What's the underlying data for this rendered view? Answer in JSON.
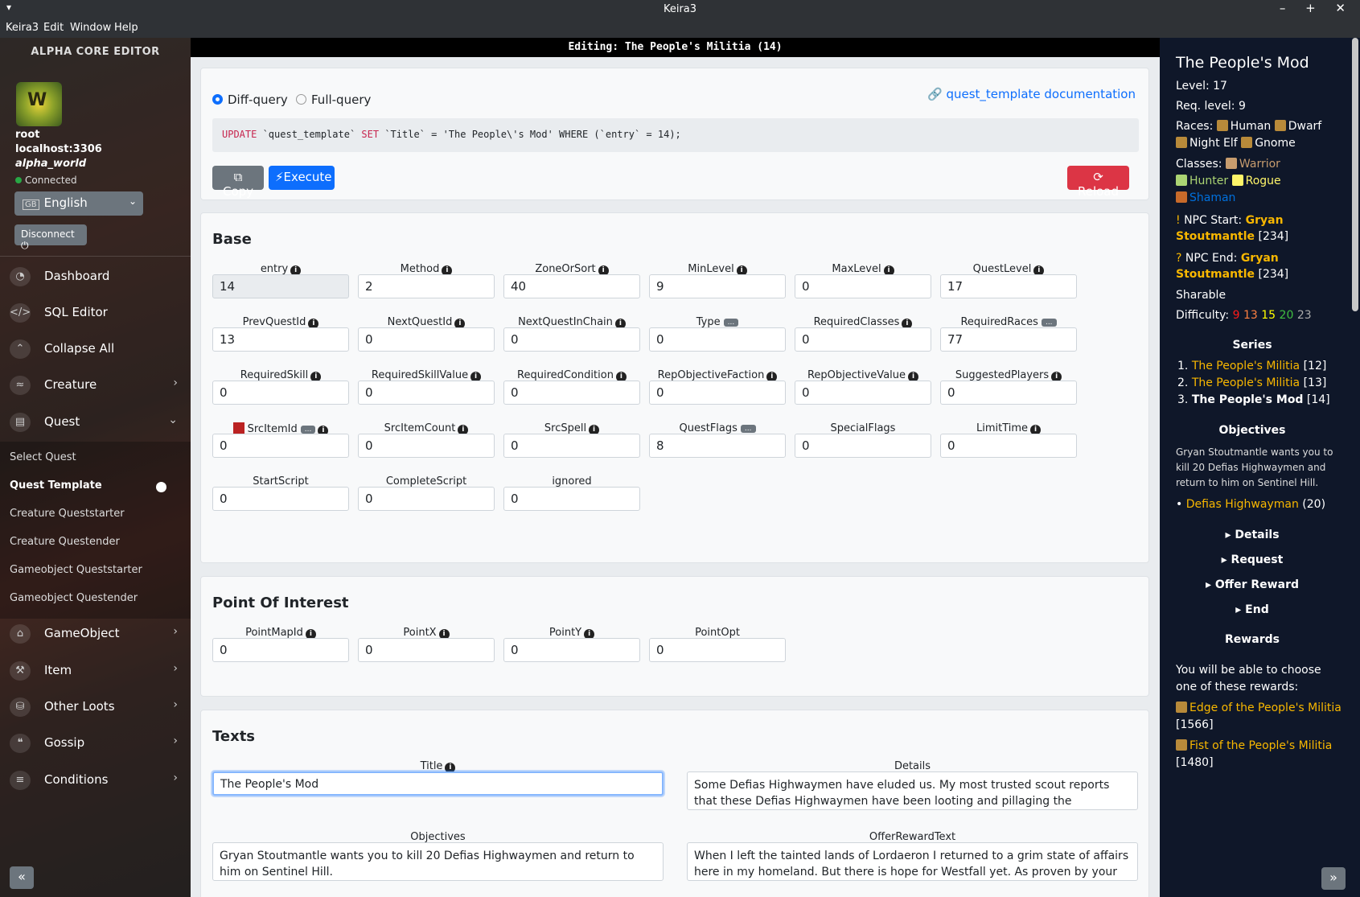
{
  "window": {
    "title": "Keira3",
    "menu_icon": "▾",
    "controls": "– + ✕"
  },
  "menubar": [
    "Keira3",
    "Edit",
    "Window",
    "Help"
  ],
  "sidebar": {
    "header": "ALPHA CORE EDITOR",
    "user": "root",
    "host": "localhost:3306",
    "db": "alpha_world",
    "status": "Connected",
    "language": "English",
    "disconnect": "Disconnect ⏻",
    "nav": [
      {
        "label": "Dashboard",
        "icon": "dashboard-icon"
      },
      {
        "label": "SQL Editor",
        "icon": "code-icon"
      },
      {
        "label": "Collapse All",
        "icon": "collapse-icon"
      },
      {
        "label": "Creature",
        "icon": "creature-icon"
      },
      {
        "label": "Quest",
        "icon": "quest-icon"
      }
    ],
    "quest_sub": [
      "Select Quest",
      "Quest Template",
      "Creature Queststarter",
      "Creature Questender",
      "Gameobject Queststarter",
      "Gameobject Questender"
    ],
    "nav2": [
      {
        "label": "GameObject",
        "icon": "gameobject-icon"
      },
      {
        "label": "Item",
        "icon": "item-icon"
      },
      {
        "label": "Other Loots",
        "icon": "loot-icon"
      },
      {
        "label": "Gossip",
        "icon": "gossip-icon"
      },
      {
        "label": "Conditions",
        "icon": "conditions-icon"
      }
    ]
  },
  "editor": {
    "header": "Editing: The People's Militia (14)",
    "diff_query": "Diff-query",
    "full_query": "Full-query",
    "doc_link": "quest_template documentation",
    "sql": {
      "kw1": "UPDATE",
      "p1": " `quest_template` ",
      "kw2": "SET",
      "p2": " `Title` = 'The People\\'s Mod' WHERE (`entry` = 14);"
    },
    "copy": "Copy",
    "execute": "Execute",
    "reload": "Reload"
  },
  "base": {
    "title": "Base",
    "fields": [
      {
        "label": "entry",
        "value": "14"
      },
      {
        "label": "Method",
        "value": "2"
      },
      {
        "label": "ZoneOrSort",
        "value": "40"
      },
      {
        "label": "MinLevel",
        "value": "9"
      },
      {
        "label": "MaxLevel",
        "value": "0"
      },
      {
        "label": "QuestLevel",
        "value": "17"
      },
      {
        "label": "PrevQuestId",
        "value": "13"
      },
      {
        "label": "NextQuestId",
        "value": "0"
      },
      {
        "label": "NextQuestInChain",
        "value": "0"
      },
      {
        "label": "Type",
        "value": "0"
      },
      {
        "label": "RequiredClasses",
        "value": "0"
      },
      {
        "label": "RequiredRaces",
        "value": "77"
      },
      {
        "label": "RequiredSkill",
        "value": "0"
      },
      {
        "label": "RequiredSkillValue",
        "value": "0"
      },
      {
        "label": "RequiredCondition",
        "value": "0"
      },
      {
        "label": "RepObjectiveFaction",
        "value": "0"
      },
      {
        "label": "RepObjectiveValue",
        "value": "0"
      },
      {
        "label": "SuggestedPlayers",
        "value": "0"
      },
      {
        "label": "SrcItemId",
        "value": "0"
      },
      {
        "label": "SrcItemCount",
        "value": "0"
      },
      {
        "label": "SrcSpell",
        "value": "0"
      },
      {
        "label": "QuestFlags",
        "value": "8"
      },
      {
        "label": "SpecialFlags",
        "value": "0"
      },
      {
        "label": "LimitTime",
        "value": "0"
      },
      {
        "label": "StartScript",
        "value": "0"
      },
      {
        "label": "CompleteScript",
        "value": "0"
      },
      {
        "label": "ignored",
        "value": "0"
      }
    ],
    "dots": "..."
  },
  "poi": {
    "title": "Point Of Interest",
    "fields": [
      {
        "label": "PointMapId",
        "value": "0"
      },
      {
        "label": "PointX",
        "value": "0"
      },
      {
        "label": "PointY",
        "value": "0"
      },
      {
        "label": "PointOpt",
        "value": "0"
      }
    ]
  },
  "texts": {
    "title": "Texts",
    "title_label": "Title",
    "title_value": "The People's Mod",
    "details_label": "Details",
    "details_value": "Some Defias Highwaymen have eluded us.  My most trusted scout reports that these Defias Highwaymen have been looting and pillaging the countryside, all the",
    "objectives_label": "Objectives",
    "objectives_value": "Gryan Stoutmantle wants you to kill 20 Defias Highwaymen and return to him on Sentinel Hill.",
    "offer_label": "OfferRewardText",
    "offer_value": "When I left the tainted lands of Lordaeron I returned to a grim state of affairs here in my homeland. But there is hope for Westfall yet. As proven by your valor"
  },
  "preview": {
    "title": "The People's Mod",
    "level": "Level: 17",
    "req_level": "Req. level: 9",
    "races_label": "Races:",
    "races": [
      "Human",
      "Dwarf",
      "Night Elf",
      "Gnome"
    ],
    "classes_label": "Classes:",
    "classes": [
      "Warrior",
      "Hunter",
      "Rogue",
      "Shaman"
    ],
    "npc_start_label": "NPC Start:",
    "npc_start": "Gryan Stoutmantle",
    "npc_start_id": "[234]",
    "npc_end_label": "NPC End:",
    "npc_end": "Gryan Stoutmantle",
    "npc_end_id": "[234]",
    "sharable": "Sharable",
    "difficulty_label": "Difficulty:",
    "difficulty": [
      "9",
      "13",
      "15",
      "20",
      "23"
    ],
    "series_title": "Series",
    "series": [
      {
        "num": "1.",
        "name": "The People's Militia",
        "id": "[12]"
      },
      {
        "num": "2.",
        "name": "The People's Militia",
        "id": "[13]"
      },
      {
        "num": "3.",
        "name": "The People's Mod",
        "id": "[14]"
      }
    ],
    "objectives_title": "Objectives",
    "objectives_text": "Gryan Stoutmantle wants you to kill 20 Defias Highwaymen and return to him on Sentinel Hill.",
    "objective_item": "Defias Highwayman",
    "objective_count": "(20)",
    "details": "Details",
    "request": "Request",
    "offer_reward": "Offer Reward",
    "end": "End",
    "rewards_title": "Rewards",
    "rewards_text": "You will be able to choose one of these rewards:",
    "reward1": "Edge of the People's Militia",
    "reward1_id": "[1566]",
    "reward2": "Fist of the People's Militia",
    "reward2_id": "[1480]"
  },
  "colors": {
    "primary": "#0d6efd",
    "danger": "#dc3545",
    "gold": "#f8b700",
    "shaman": "#0070dd",
    "panel": "#0f1729"
  }
}
